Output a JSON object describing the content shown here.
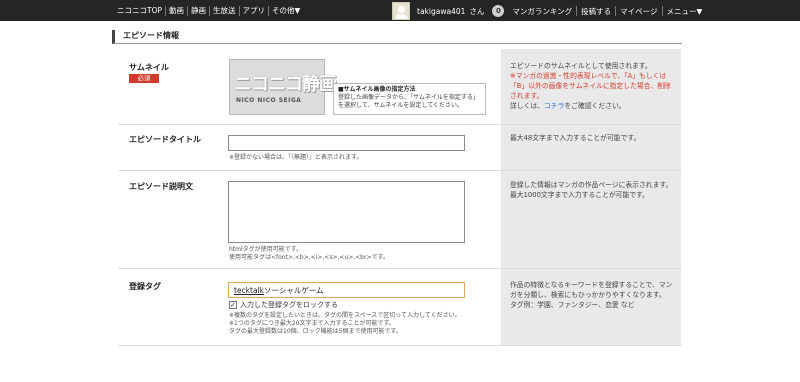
{
  "nav": {
    "left_items": [
      "ニコニコTOP",
      "動画",
      "静画",
      "生放送",
      "アプリ",
      "その他▼"
    ],
    "user_name": "takigawa401",
    "user_suffix": "さん",
    "badge": "0",
    "right_items": [
      "マンガランキング",
      "投稿する",
      "マイページ",
      "メニュー▼"
    ]
  },
  "section_title": "エピソード情報",
  "thumbnail": {
    "label": "サムネイル",
    "required": "必須",
    "placeholder_main": "ニコニコ静画",
    "placeholder_sub": "NICO NICO SEIGA",
    "note_title": "■サムネイル画像の指定方法",
    "note_body": "登録した画像データから、「サムネイルを指定する」を選択して、サムネイルを設定してください。",
    "desc_1": "エピソードのサムネイルとして使用されます。",
    "desc_red": "※マンガの過激・性的表現レベルで、「A」もしくは「B」以外の画像をサムネイルに指定した場合、削除されます。",
    "desc_2": "詳しくは、",
    "desc_link": "コチラ",
    "desc_3": "をご確認ください。"
  },
  "title_field": {
    "label": "エピソードタイトル",
    "value": "",
    "hint": "※登録がない場合は、「（無題）」と表示されます。",
    "desc": "最大48文字まで入力することが可能です。"
  },
  "description_field": {
    "label": "エピソード説明文",
    "value": "",
    "hint_1": "htmlタグが使用可能です。",
    "hint_2": "使用可能タグは<font>,<b>,<i>,<s>,<u>,<br>です。",
    "desc": "登録した情報はマンガの作品ページに表示されます。最大1000文字まで入力することが可能です。"
  },
  "tags_field": {
    "label": "登録タグ",
    "token": "tecktalk",
    "value_rest": "ソーシャルゲーム",
    "lock_checked": "✓",
    "lock_label": "入力した登録タグをロックする",
    "hint_1": "※複数のタグを設定したいときは、タグの間をスペースで区切って入力してください。",
    "hint_2": "※1つのタグにつき最大20文字まで入力することが可能です。",
    "hint_3": "タグの最大登録数は10個、ロック機能は5個まで使用可能です。",
    "desc": "作品の特徴となるキーワードを登録することで、マンガを分類し、検索にもひっかかりやすくなります。",
    "desc_example": "タグ例：学園、ファンタジー、恋愛 など"
  }
}
